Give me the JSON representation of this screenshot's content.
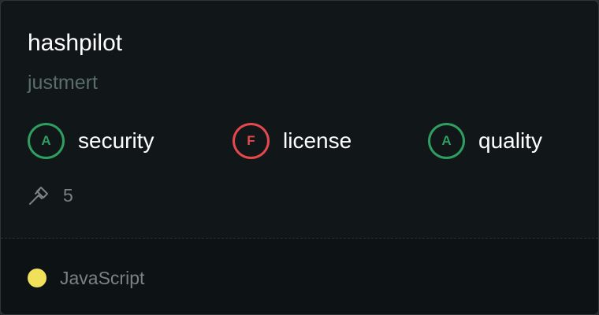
{
  "repo": {
    "name": "hashpilot",
    "owner": "justmert"
  },
  "scores": [
    {
      "grade": "A",
      "label": "security",
      "color": "#2e9e61"
    },
    {
      "grade": "F",
      "label": "license",
      "color": "#e5484d"
    },
    {
      "grade": "A",
      "label": "quality",
      "color": "#2e9e61"
    }
  ],
  "stats": {
    "icon": "hammer-icon",
    "count": "5"
  },
  "language": {
    "name": "JavaScript",
    "color": "#f1e05a"
  }
}
